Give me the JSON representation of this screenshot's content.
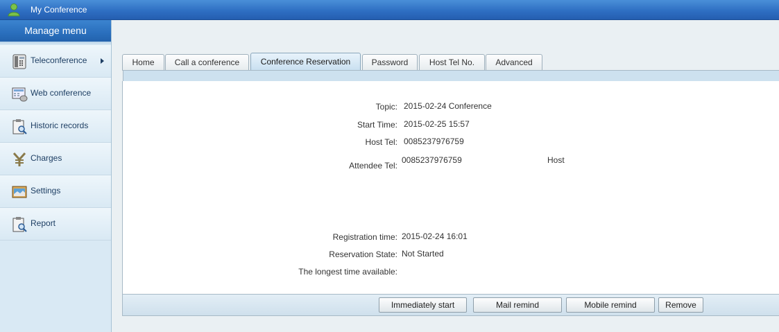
{
  "window": {
    "title": "My Conference"
  },
  "sidebar": {
    "header": "Manage menu",
    "items": [
      {
        "label": "Teleconference",
        "icon": "phone-icon"
      },
      {
        "label": "Web conference",
        "icon": "web-conference-icon"
      },
      {
        "label": "Historic records",
        "icon": "clipboard-search-icon"
      },
      {
        "label": "Charges",
        "icon": "yen-icon"
      },
      {
        "label": "Settings",
        "icon": "settings-window-icon"
      },
      {
        "label": "Report",
        "icon": "report-search-icon"
      }
    ]
  },
  "tabs": [
    {
      "label": "Home"
    },
    {
      "label": "Call a conference"
    },
    {
      "label": "Conference Reservation",
      "active": true
    },
    {
      "label": "Password"
    },
    {
      "label": "Host Tel No."
    },
    {
      "label": "Advanced"
    }
  ],
  "details": {
    "topic_label": "Topic:",
    "topic": "2015-02-24 Conference",
    "start_time_label": "Start Time:",
    "start_time": "2015-02-25 15:57",
    "host_tel_label": "Host Tel:",
    "host_tel": "0085237976759",
    "attendee_tel_label": "Attendee Tel:",
    "attendee_tel": "0085237976759",
    "attendee_role": "Host",
    "registration_time_label": "Registration time:",
    "registration_time": "2015-02-24 16:01",
    "reservation_state_label": "Reservation State:",
    "reservation_state": "Not Started",
    "longest_time_label": "The longest time available:",
    "longest_time": ""
  },
  "actions": {
    "immediately_start": "Immediately start",
    "mail_remind": "Mail remind",
    "mobile_remind": "Mobile remind",
    "remove": "Remove"
  },
  "colors": {
    "titlebar": "#2f6fc3",
    "sidebar_bg": "#d9e9f4",
    "active_tab": "#c8dff0"
  }
}
